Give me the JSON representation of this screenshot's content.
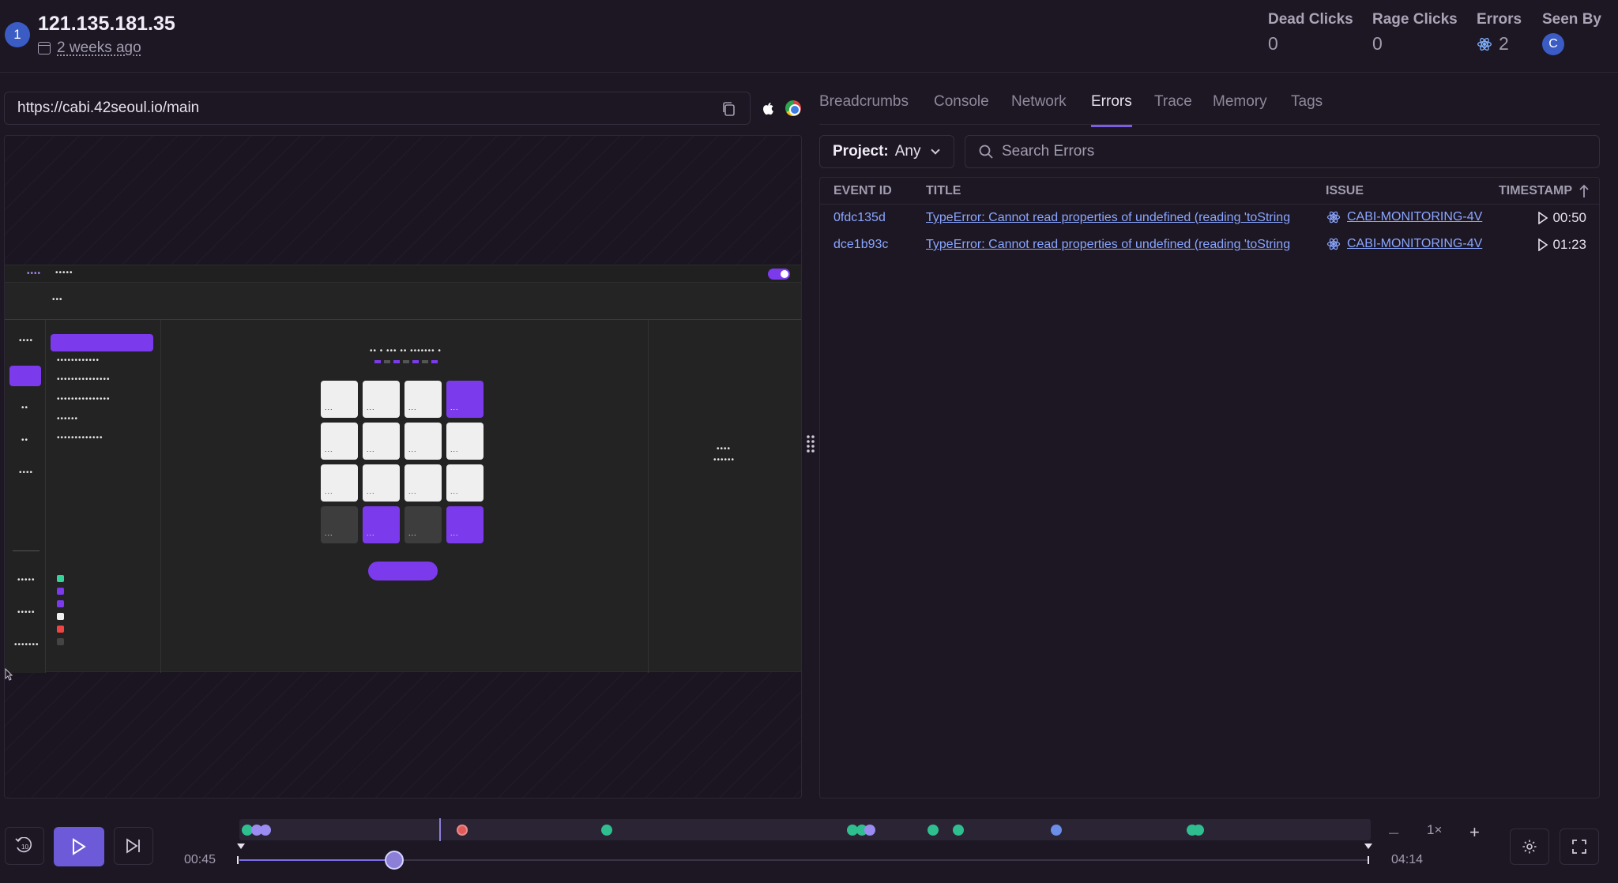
{
  "header": {
    "avatar_number": "1",
    "ip": "121.135.181.35",
    "date": "2 weeks ago",
    "stats": [
      {
        "label": "Dead Clicks",
        "value": "0"
      },
      {
        "label": "Rage Clicks",
        "value": "0"
      },
      {
        "label": "Errors",
        "value": "2"
      },
      {
        "label": "Seen By",
        "value": "C"
      }
    ]
  },
  "url": "https://cabi.42seoul.io/main",
  "tabs": [
    "Breadcrumbs",
    "Console",
    "Network",
    "Errors",
    "Trace",
    "Memory",
    "Tags"
  ],
  "active_tab": "Errors",
  "filters": {
    "project_label": "Project:",
    "project_value": "Any",
    "search_placeholder": "Search Errors"
  },
  "table": {
    "columns": [
      "EVENT ID",
      "TITLE",
      "ISSUE",
      "TIMESTAMP"
    ],
    "rows": [
      {
        "event_id": "0fdc135d",
        "title": "TypeError: Cannot read properties of undefined (reading 'toString",
        "issue": "CABI-MONITORING-4V",
        "timestamp": "00:50"
      },
      {
        "event_id": "dce1b93c",
        "title": "TypeError: Cannot read properties of undefined (reading 'toString",
        "issue": "CABI-MONITORING-4V",
        "timestamp": "01:23"
      }
    ]
  },
  "player": {
    "current_time": "00:45",
    "total_time": "04:14",
    "speed": "1×",
    "skip_label": "10",
    "progress_fraction": 0.137
  },
  "colors": {
    "accent": "#6d5ad8",
    "link": "#8ba6ff",
    "app_purple": "#7c3aed"
  }
}
